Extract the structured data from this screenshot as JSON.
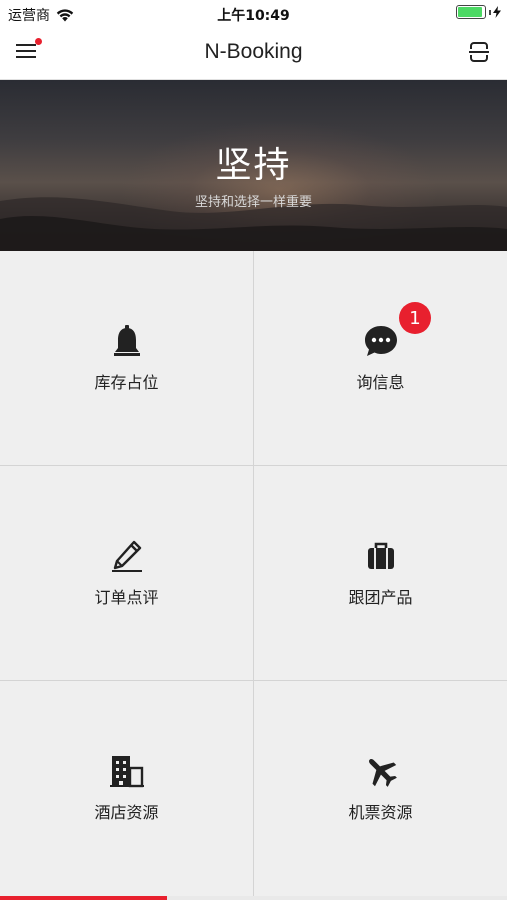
{
  "status_bar": {
    "carrier": "运营商",
    "time": "上午10:49",
    "battery_level": 1.0
  },
  "nav": {
    "title": "N-Booking",
    "menu_icon": "menu-icon",
    "scan_icon": "scan-icon",
    "menu_has_notification": true
  },
  "banner": {
    "title": "坚持",
    "subtitle": "坚持和选择一样重要"
  },
  "grid": {
    "items": [
      {
        "label": "库存占位",
        "icon": "bell-icon"
      },
      {
        "label": "询信息",
        "icon": "chat-icon",
        "badge": "1"
      },
      {
        "label": "订单点评",
        "icon": "pencil-icon"
      },
      {
        "label": "跟团产品",
        "icon": "suitcase-icon"
      },
      {
        "label": "酒店资源",
        "icon": "building-icon"
      },
      {
        "label": "机票资源",
        "icon": "airplane-icon"
      }
    ]
  },
  "page_indicator": {
    "progress": 0.33
  },
  "colors": {
    "accent": "#e8202e",
    "grid_bg": "#efefef",
    "divider": "#d4d4d4",
    "text": "#222222"
  }
}
